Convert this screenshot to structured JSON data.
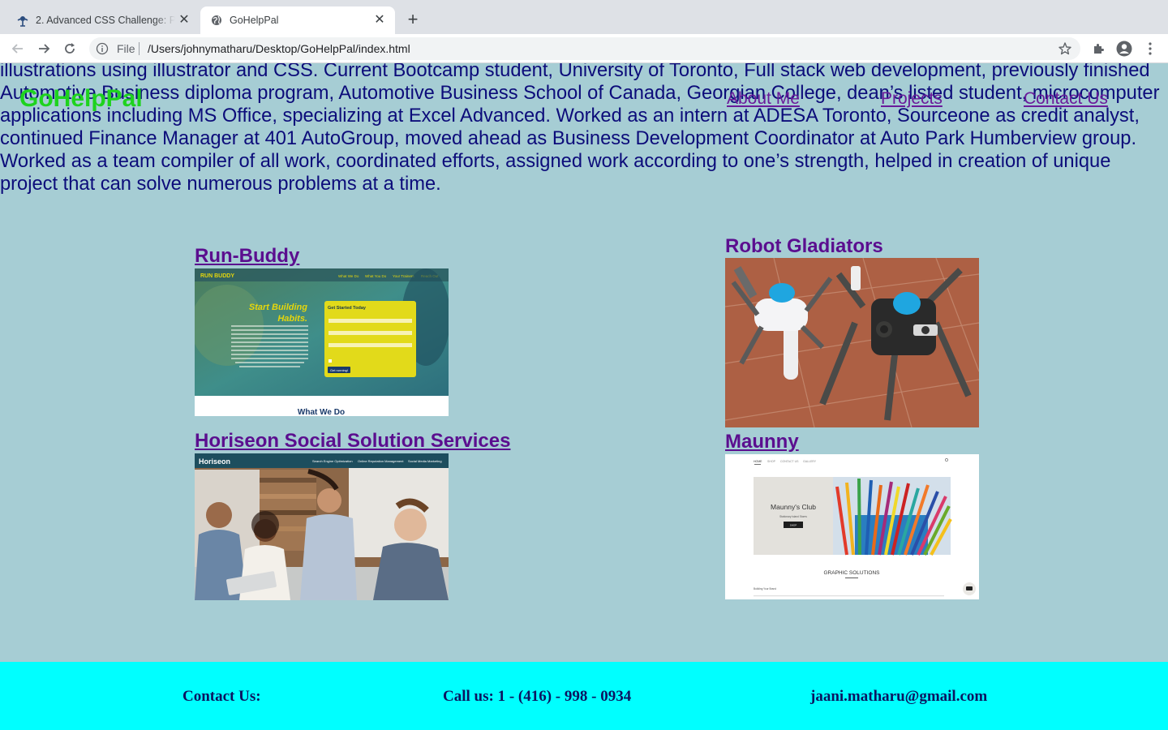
{
  "browser": {
    "tabs": [
      {
        "title": "2. Advanced CSS Challenge: Professional Portfolio",
        "active": false
      },
      {
        "title": "GoHelpPal",
        "active": true
      }
    ],
    "url_scheme": "File",
    "url": "/Users/johnymatharu/Desktop/GoHelpPal/index.html"
  },
  "page": {
    "about_text": "illustrations using illustrator and CSS. Current Bootcamp student, University of Toronto, Full stack web development, previously finished Automotive Business diploma program, Automotive Business School of Canada, Georgian College, dean’s listed student, microcomputer applications including MS Office, specializing at Excel Advanced. Worked as an intern at ADESA Toronto, Sourceone as credit analyst, continued Finance Manager at 401 AutoGroup, moved ahead as Business Development Coordinator at Auto Park Humberview group. Worked as a team compiler of all work, coordinated efforts, assigned work according to one’s strength, helped in creation of unique project that can solve numerous problems at a time.",
    "brand": "GoHelpPal",
    "nav": [
      "About Me",
      "Projects",
      "Contact Us"
    ],
    "projects": [
      {
        "title": "Run-Buddy"
      },
      {
        "title": "Robot Gladiators"
      },
      {
        "title": "Horiseon Social Solution Services"
      },
      {
        "title": "Maunny"
      }
    ],
    "thumbs": {
      "runbuddy": {
        "logo": "RUN BUDDY",
        "nav": [
          "What We Do",
          "What You Do",
          "Your Trainers",
          "Reach Out"
        ],
        "headline1": "Start Building",
        "headline2": "Habits.",
        "form_title": "Get Started Today",
        "button": "Get running!",
        "section": "What We Do"
      },
      "horiseon": {
        "logo": "Horiseon",
        "nav": [
          "Search Engine Optimization",
          "Online Reputation Management",
          "Social Media Marketing"
        ]
      },
      "maunny": {
        "nav": [
          "HOME",
          "SHOP",
          "CONTACT US",
          "GALLERY"
        ],
        "club": "Maunny's Club",
        "sub": "Stationary Island Stores",
        "button": "SHOP",
        "section": "GRAPHIC SOLUTIONS",
        "caption": "Building Your Brand"
      }
    },
    "footer": {
      "contact_label": "Contact Us:",
      "phone": "Call us: 1 - (416) - 998 - 0934",
      "email": "jaani.matharu@gmail.com"
    }
  },
  "colors": {
    "page_bg": "#a6cdd4",
    "brand": "#1ed31e",
    "link": "#5b0e8f",
    "body_text": "#0c0c7a",
    "footer_bg": "#00ffff"
  },
  "icons": [
    "globe-icon",
    "back-icon",
    "forward-icon",
    "reload-icon",
    "info-icon",
    "star-icon",
    "puzzle-icon",
    "profile-icon",
    "menu-icon",
    "close-icon",
    "plus-icon"
  ]
}
